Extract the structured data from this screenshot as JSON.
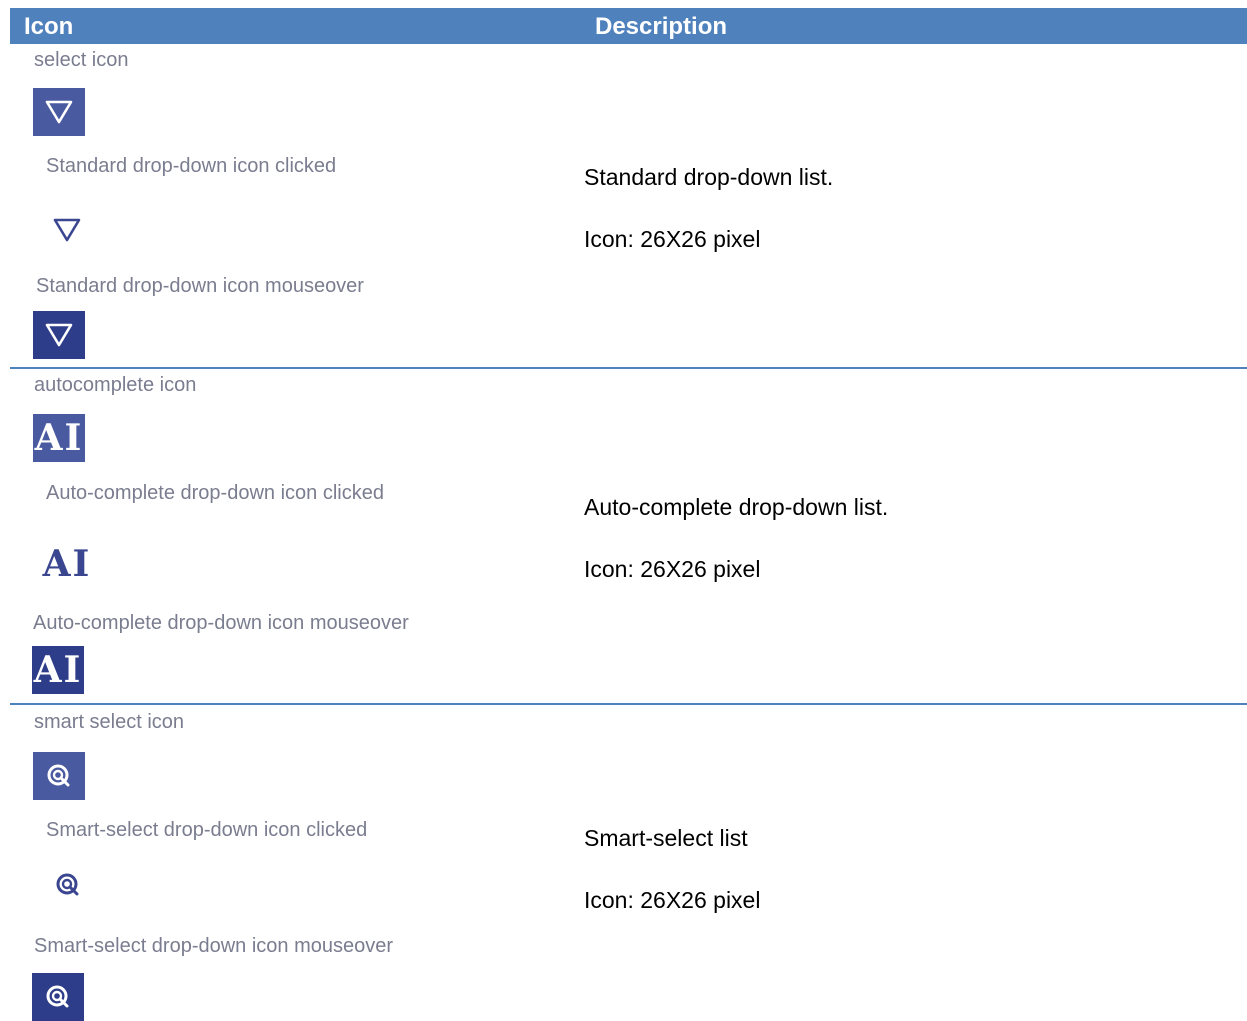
{
  "header": {
    "icon_col": "Icon",
    "desc_col": "Description"
  },
  "rows": [
    {
      "captions": [
        "select icon",
        "Standard drop-down icon clicked",
        "Standard drop-down icon mouseover"
      ],
      "description": "Standard drop-down list.",
      "size": "Icon: 26X26 pixel",
      "icon": "triangle-down-icon"
    },
    {
      "captions": [
        "autocomplete icon",
        "Auto-complete drop-down icon clicked",
        "Auto-complete drop-down icon mouseover"
      ],
      "description": "Auto-complete drop-down list.",
      "size": "Icon: 26X26 pixel",
      "icon_text": "AI"
    },
    {
      "captions": [
        "smart select icon",
        "Smart-select drop-down icon clicked",
        "Smart-select drop-down icon mouseover"
      ],
      "description": "Smart-select list",
      "size": "Icon: 26X26 pixel",
      "icon": "magnifier-circle-icon"
    }
  ],
  "colors": {
    "header_bg": "#4f81bd",
    "icon_bg": "#4a5aa0",
    "icon_bg_hover": "#2e3d8a",
    "icon_fg_plain": "#3a4690"
  }
}
